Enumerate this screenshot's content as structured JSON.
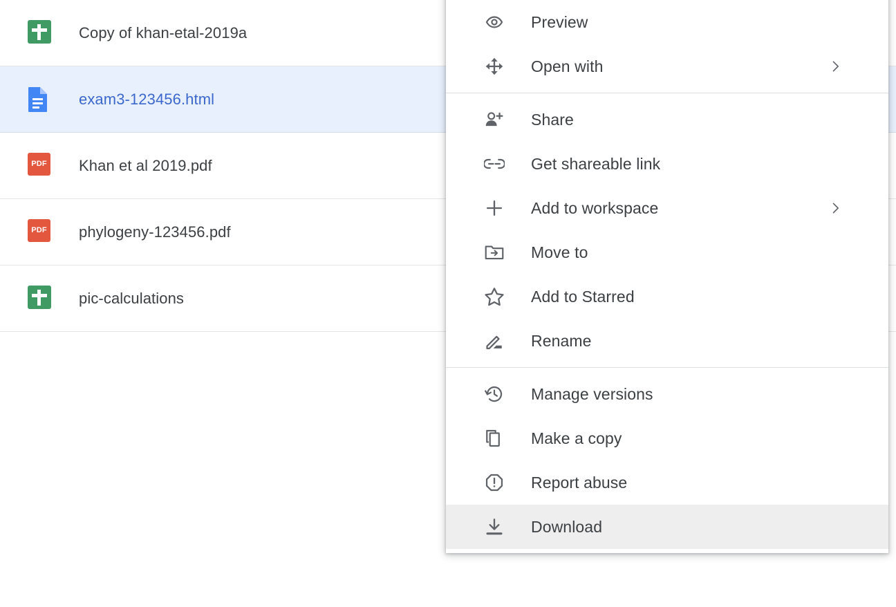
{
  "file_list": {
    "rows": [
      {
        "name": "Copy of khan-etal-2019a",
        "icon": "sheets-icon",
        "type": "sheet",
        "selected": false
      },
      {
        "name": "exam3-123456.html",
        "icon": "document-icon",
        "type": "doc",
        "selected": true
      },
      {
        "name": "Khan et al 2019.pdf",
        "icon": "pdf-icon",
        "type": "pdf",
        "pdf_label": "PDF",
        "selected": false
      },
      {
        "name": "phylogeny-123456.pdf",
        "icon": "pdf-icon",
        "type": "pdf",
        "pdf_label": "PDF",
        "selected": false
      },
      {
        "name": "pic-calculations",
        "icon": "sheets-icon",
        "type": "sheet",
        "selected": false
      }
    ]
  },
  "context_menu": {
    "groups": [
      {
        "items": [
          {
            "label": "Preview",
            "icon": "eye-icon",
            "submenu": false,
            "hovered": false
          },
          {
            "label": "Open with",
            "icon": "open-with-icon",
            "submenu": true,
            "hovered": false
          }
        ]
      },
      {
        "items": [
          {
            "label": "Share",
            "icon": "person-add-icon",
            "submenu": false,
            "hovered": false
          },
          {
            "label": "Get shareable link",
            "icon": "link-icon",
            "submenu": false,
            "hovered": false
          },
          {
            "label": "Add to workspace",
            "icon": "plus-icon",
            "submenu": true,
            "hovered": false
          },
          {
            "label": "Move to",
            "icon": "move-to-folder-icon",
            "submenu": false,
            "hovered": false
          },
          {
            "label": "Add to Starred",
            "icon": "star-outline-icon",
            "submenu": false,
            "hovered": false
          },
          {
            "label": "Rename",
            "icon": "pencil-icon",
            "submenu": false,
            "hovered": false
          }
        ]
      },
      {
        "items": [
          {
            "label": "Manage versions",
            "icon": "history-icon",
            "submenu": false,
            "hovered": false
          },
          {
            "label": "Make a copy",
            "icon": "copy-icon",
            "submenu": false,
            "hovered": false
          },
          {
            "label": "Report abuse",
            "icon": "report-abuse-icon",
            "submenu": false,
            "hovered": false
          },
          {
            "label": "Download",
            "icon": "download-icon",
            "submenu": false,
            "hovered": true
          }
        ]
      }
    ]
  },
  "colors": {
    "selected_row_bg": "#e8f0fe",
    "selected_row_text": "#3c68cd",
    "hover_bg": "#eeeeee",
    "sheets_green": "#3f9a63",
    "pdf_red": "#e3573f",
    "doc_blue": "#4285f4",
    "text_primary": "#3c4043",
    "icon_gray": "#5f6368",
    "divider": "#e3e4e8"
  }
}
